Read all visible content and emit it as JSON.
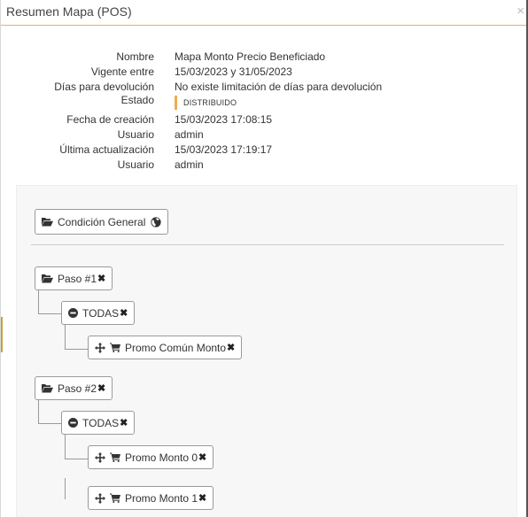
{
  "modal": {
    "title": "Resumen Mapa (POS)",
    "close": "×"
  },
  "info": [
    {
      "label": "Nombre",
      "value": "Mapa Monto Precio Beneficiado"
    },
    {
      "label": "Vigente entre",
      "value": "15/03/2023 y 31/05/2023"
    },
    {
      "label": "Días para devolución",
      "value": "No existe limitación de días para devolución"
    },
    {
      "label": "Estado",
      "value": "DISTRIBUIDO"
    },
    {
      "label": "Fecha de creación",
      "value": "15/03/2023 17:08:15"
    },
    {
      "label": "Usuario",
      "value": "admin"
    },
    {
      "label": "Última actualización",
      "value": "15/03/2023 17:19:17"
    },
    {
      "label": "Usuario",
      "value": "admin"
    }
  ],
  "tree": {
    "root": {
      "label": "Condición General"
    },
    "steps": [
      {
        "label": "Paso #1",
        "group": "TODAS",
        "items": [
          "Promo Común Monto"
        ]
      },
      {
        "label": "Paso #2",
        "group": "TODAS",
        "items": [
          "Promo Monto 0",
          "Promo Monto 1"
        ]
      }
    ]
  },
  "colors": {
    "accent": "#f0ad4e",
    "panel": "#f7f7f7",
    "node_border": "#9a9a9a"
  },
  "icons": [
    "folder-open-icon",
    "globe-icon",
    "minus-circle-icon",
    "move-icon",
    "cart-icon",
    "remove-icon",
    "close-icon"
  ]
}
